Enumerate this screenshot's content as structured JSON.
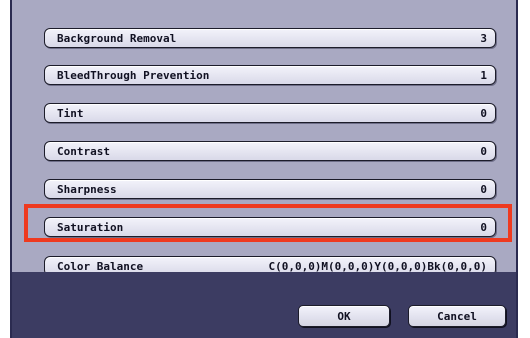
{
  "settings": [
    {
      "label": "Background Removal",
      "value": "3"
    },
    {
      "label": "BleedThrough Prevention",
      "value": "1"
    },
    {
      "label": "Tint",
      "value": "0"
    },
    {
      "label": "Contrast",
      "value": "0"
    },
    {
      "label": "Sharpness",
      "value": "0"
    },
    {
      "label": "Saturation",
      "value": "0"
    },
    {
      "label": "Color Balance",
      "value": "C(0,0,0)M(0,0,0)Y(0,0,0)Bk(0,0,0)"
    }
  ],
  "buttons": {
    "ok": "OK",
    "cancel": "Cancel"
  },
  "colors": {
    "highlight": "#ee3a1f",
    "panel": "#a9a9c2",
    "footer": "#3c3c62"
  }
}
